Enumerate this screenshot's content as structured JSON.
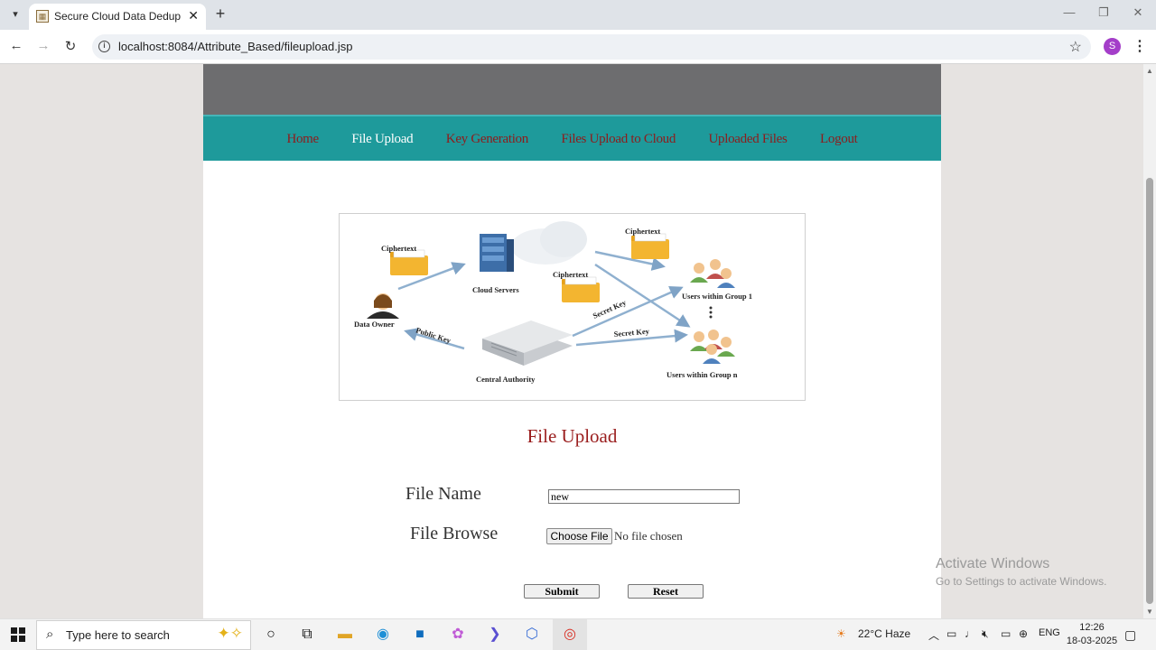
{
  "browser": {
    "tab_title": "Secure Cloud Data Deduplicato",
    "url": "localhost:8084/Attribute_Based/fileupload.jsp",
    "profile_initial": "S"
  },
  "site": {
    "menu": [
      {
        "label": "Home",
        "active": false
      },
      {
        "label": "File Upload",
        "active": true
      },
      {
        "label": "Key Generation",
        "active": false
      },
      {
        "label": "Files Upload to Cloud",
        "active": false
      },
      {
        "label": "Uploaded Files",
        "active": false
      },
      {
        "label": "Logout",
        "active": false
      }
    ],
    "colors": {
      "menu_bg": "#1e9a9b",
      "menu_text": "#8e1c1c",
      "menu_active": "#ffffff",
      "title": "#9a1e1e",
      "banner": "#6d6d6f"
    }
  },
  "diagram": {
    "ciphertext_1": "Ciphertext",
    "ciphertext_2": "Ciphertext",
    "ciphertext_3": "Ciphertext",
    "cloud_servers": "Cloud Servers",
    "data_owner": "Data Owner",
    "public_key": "Public Key",
    "central_authority": "Central Authority",
    "secret_key_1": "Secret Key",
    "secret_key_2": "Secret Key",
    "group_1": "Users within Group 1",
    "group_n": "Users within Group n"
  },
  "form": {
    "title": "File Upload",
    "file_name_label": "File Name",
    "file_name_value": "new",
    "file_browse_label": "File Browse",
    "choose_file": "Choose File",
    "no_file": "No file chosen",
    "submit": "Submit",
    "reset": "Reset"
  },
  "watermark": {
    "line1": "Activate Windows",
    "line2": "Go to Settings to activate Windows."
  },
  "taskbar": {
    "search_placeholder": "Type here to search",
    "weather": "22°C  Haze",
    "language": "ENG",
    "time": "12:26",
    "date": "18-03-2025"
  }
}
